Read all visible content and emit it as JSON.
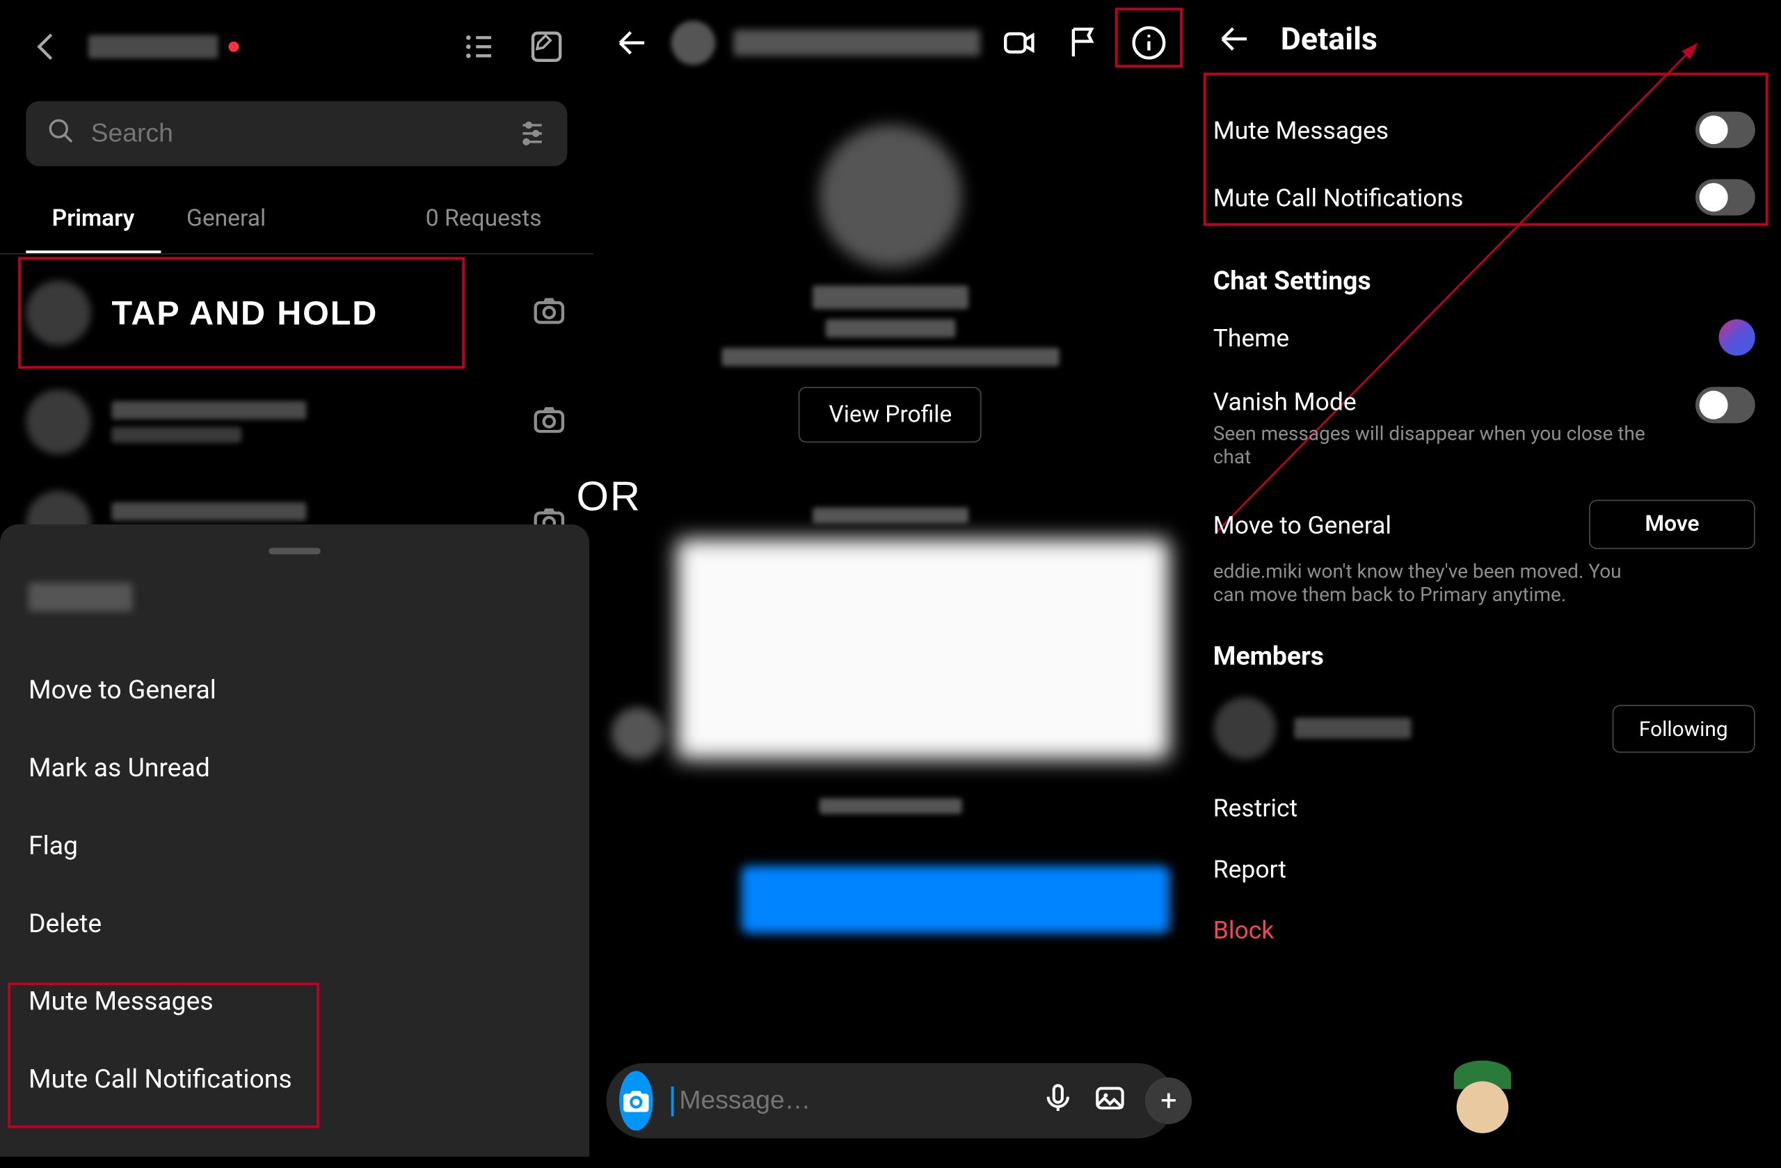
{
  "panel1": {
    "search_placeholder": "Search",
    "tabs": {
      "primary": "Primary",
      "general": "General",
      "requests": "0 Requests"
    },
    "tap_hold_label": "TAP AND HOLD",
    "context_menu": {
      "move_general": "Move to General",
      "mark_unread": "Mark as Unread",
      "flag": "Flag",
      "delete": "Delete",
      "mute_messages": "Mute Messages",
      "mute_calls": "Mute Call Notifications"
    }
  },
  "or_label": "OR",
  "panel2": {
    "view_profile": "View Profile",
    "compose_placeholder": "Message…"
  },
  "panel3": {
    "title": "Details",
    "mute_messages": "Mute Messages",
    "mute_calls": "Mute Call Notifications",
    "chat_settings": "Chat Settings",
    "theme": "Theme",
    "vanish_mode": "Vanish Mode",
    "vanish_sub": "Seen messages will disappear when you close the chat",
    "move_general": "Move to General",
    "move_btn": "Move",
    "move_sub": "eddie.miki won't know they've been moved. You can move them back to Primary anytime.",
    "members": "Members",
    "following": "Following",
    "restrict": "Restrict",
    "report": "Report",
    "block": "Block"
  }
}
